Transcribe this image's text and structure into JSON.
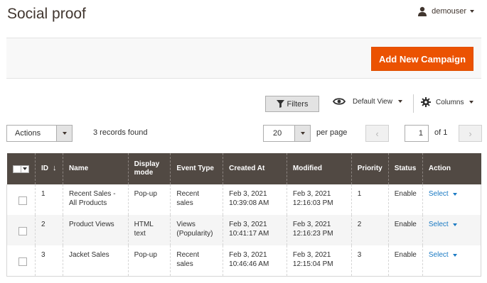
{
  "header": {
    "title": "Social proof",
    "username": "demouser"
  },
  "action_bar": {
    "add_button_label": "Add New Campaign"
  },
  "toolbar": {
    "filters_label": "Filters",
    "view_label": "Default View",
    "columns_label": "Columns",
    "actions_label": "Actions",
    "records_found": "3 records found",
    "per_page_value": "20",
    "per_page_label": "per page",
    "current_page": "1",
    "page_of": "of 1",
    "prev_glyph": "‹",
    "next_glyph": "›"
  },
  "grid": {
    "columns": [
      "ID",
      "Name",
      "Display mode",
      "Event Type",
      "Created At",
      "Modified",
      "Priority",
      "Status",
      "Action"
    ],
    "sort_glyph": "↓",
    "rows": [
      {
        "id": "1",
        "name": "Recent Sales - All Products",
        "display_mode": "Pop-up",
        "event_type": "Recent sales",
        "created_date": "Feb 3, 2021",
        "created_time": "10:39:08 AM",
        "modified_date": "Feb 3, 2021",
        "modified_time": "12:16:03 PM",
        "priority": "1",
        "status": "Enable",
        "action": "Select"
      },
      {
        "id": "2",
        "name": "Product Views",
        "display_mode": "HTML text",
        "event_type": "Views (Popularity)",
        "created_date": "Feb 3, 2021",
        "created_time": "10:41:17 AM",
        "modified_date": "Feb 3, 2021",
        "modified_time": "12:16:23 PM",
        "priority": "2",
        "status": "Enable",
        "action": "Select"
      },
      {
        "id": "3",
        "name": "Jacket Sales",
        "display_mode": "Pop-up",
        "event_type": "Recent sales",
        "created_date": "Feb 3, 2021",
        "created_time": "10:46:46 AM",
        "modified_date": "Feb 3, 2021",
        "modified_time": "12:15:04 PM",
        "priority": "3",
        "status": "Enable",
        "action": "Select"
      }
    ]
  },
  "colors": {
    "accent": "#eb5202",
    "header_bg": "#514943",
    "link": "#1979c3"
  },
  "icons": [
    "user-icon",
    "filter-icon",
    "eye-icon",
    "gear-icon",
    "chevron-down-icon"
  ]
}
